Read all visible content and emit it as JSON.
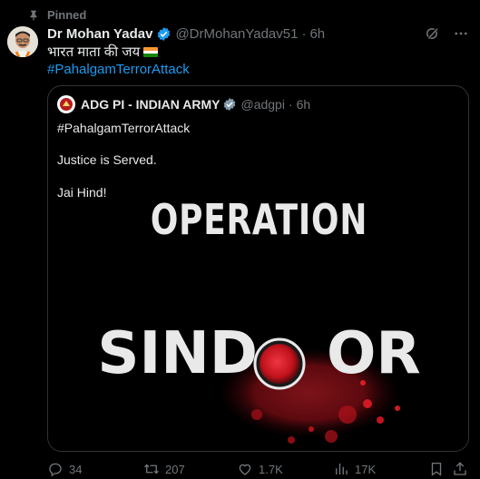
{
  "pinned": {
    "label": "Pinned"
  },
  "tweet": {
    "author_name": "Dr Mohan Yadav",
    "handle": "@DrMohanYadav51",
    "separator": "·",
    "time": "6h",
    "text_line1": "भारत माता की जय",
    "hashtag": "#PahalgamTerrorAttack"
  },
  "quote": {
    "author_name": "ADG PI - INDIAN ARMY",
    "handle": "@adgpi",
    "separator": "·",
    "time": "6h",
    "line1": "#PahalgamTerrorAttack",
    "line2": "Justice is Served.",
    "line3": "Jai Hind!",
    "image_text_top": "OPERATION",
    "image_text_bottom_left": "SIND",
    "image_text_bottom_right": "OR"
  },
  "actions": {
    "replies": "34",
    "reposts": "207",
    "likes": "1.7K",
    "views": "17K"
  },
  "icons": [
    "pin-icon",
    "verified-icon",
    "grok-icon",
    "more-icon",
    "reply-icon",
    "repost-icon",
    "like-icon",
    "views-icon",
    "bookmark-icon",
    "share-icon"
  ],
  "colors": {
    "background": "#000000",
    "text": "#e7e9ea",
    "muted": "#71767b",
    "link": "#1d9bf0",
    "border": "#2f3336",
    "verified": "#1d9bf0",
    "sindoor_red": "#c8102e"
  }
}
